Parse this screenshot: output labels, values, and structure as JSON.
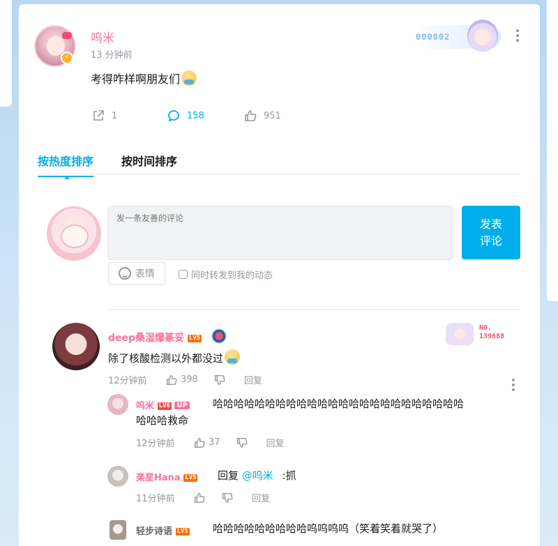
{
  "post": {
    "username": "呜米",
    "time": "13 分钟前",
    "text": "考得咋样啊朋友们",
    "fan_badge": "000002",
    "actions": {
      "share_count": "1",
      "comment_count": "158",
      "like_count": "951"
    }
  },
  "tabs": [
    {
      "label": "按热度排序",
      "active": true
    },
    {
      "label": "按时间排序",
      "active": false
    }
  ],
  "composer": {
    "placeholder": "发一条友善的评论",
    "send_label_1": "发表",
    "send_label_2": "评论",
    "emoji_label": "表情",
    "repost_label": "同时转发到我的动态"
  },
  "comments": [
    {
      "username": "deep桑湿爆篆妥",
      "level": "LV5",
      "nameplate_line1": "NO.",
      "nameplate_line2": "139688",
      "text": "除了核酸检测以外都没过",
      "time": "12分钟前",
      "likes": "398",
      "reply_label": "回复",
      "replies": [
        {
          "username": "呜米",
          "level": "LV6",
          "up_tag": "UP",
          "text_line1": "哈哈哈哈哈哈哈哈哈哈哈哈哈哈哈哈哈哈哈哈哈哈哈哈",
          "text_line2": "哈哈哈救命",
          "time": "12分钟前",
          "likes": "37",
          "reply_label": "回复"
        },
        {
          "username": "楽星Hana",
          "level": "LV5",
          "reply_prefix": "回复",
          "mention": "@呜米",
          "text": ":抓",
          "time": "11分钟前",
          "reply_label": "回复"
        },
        {
          "username": "轻步诗语",
          "level": "LV5",
          "text": "哈哈哈哈哈哈哈哈哈呜呜呜呜（笑着笑着就哭了）"
        }
      ]
    }
  ],
  "colors": {
    "accent": "#00aeec",
    "username_pink": "#fb7299",
    "muted": "#9499a0"
  }
}
